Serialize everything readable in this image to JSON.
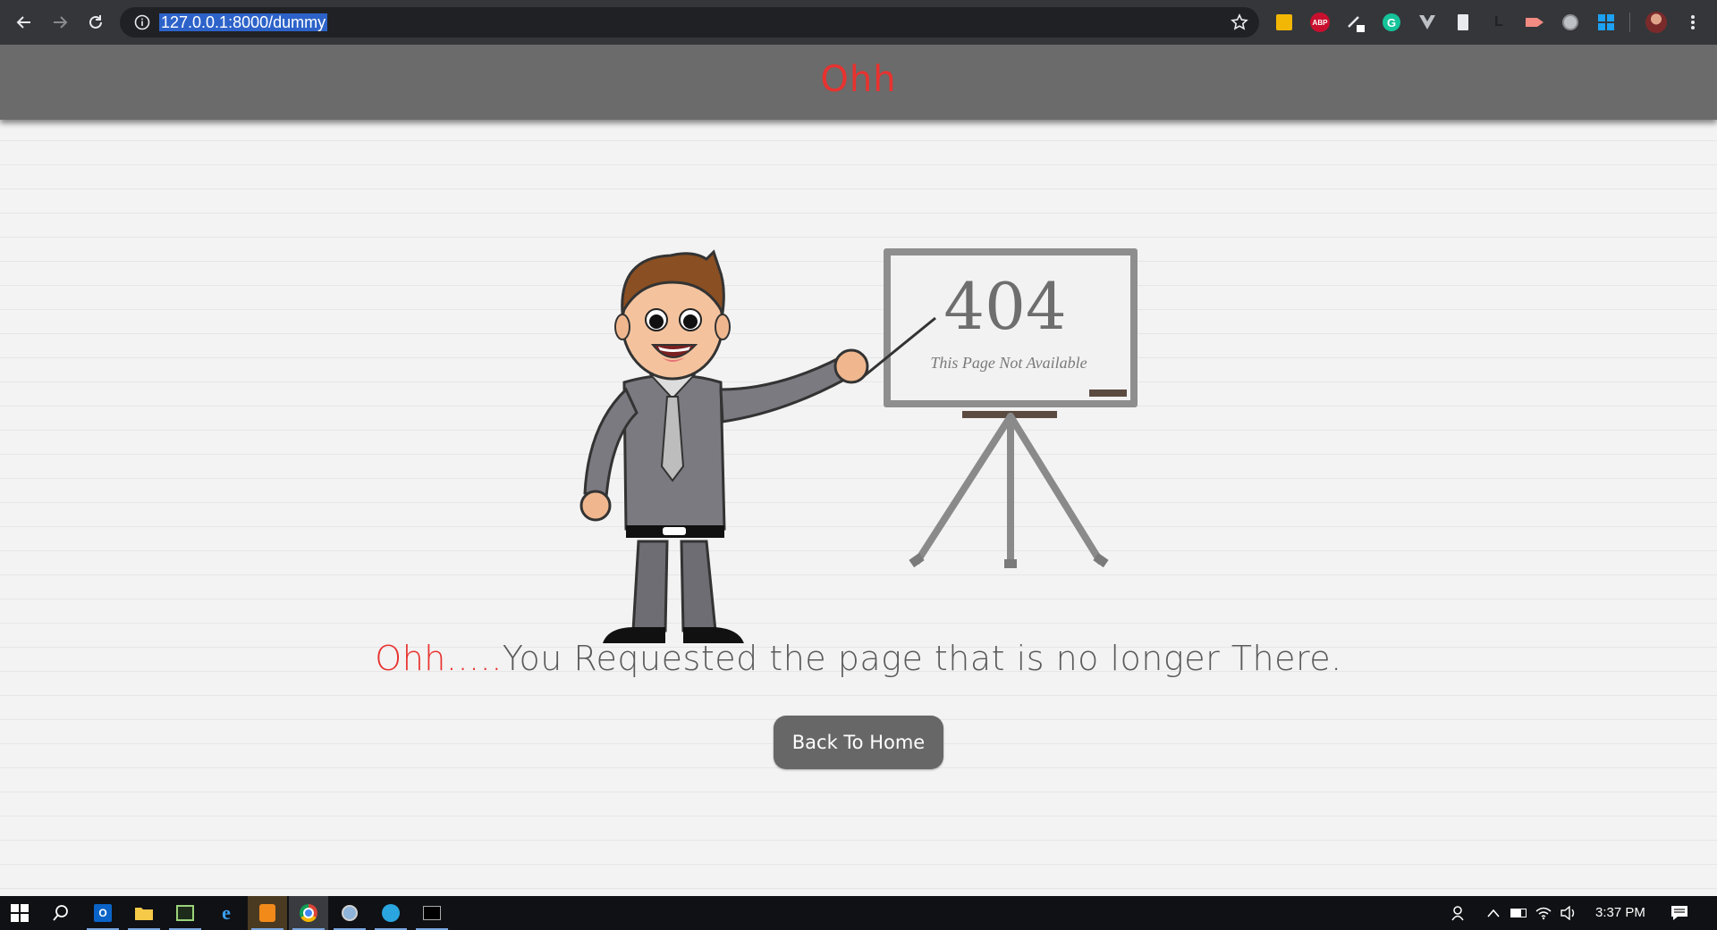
{
  "browser": {
    "url": "127.0.0.1:8000/dummy",
    "icons": [
      "back-arrow-icon",
      "forward-arrow-icon",
      "reload-icon",
      "site-info-icon",
      "bookmark-star-icon",
      "menu-dots-icon"
    ],
    "extensions": [
      "notes-extension-icon",
      "adblock-plus-icon",
      "pen-extension-icon",
      "grammarly-icon",
      "vue-devtools-icon",
      "clipboard-extension-icon",
      "l-extension-icon",
      "video-extension-icon",
      "circle-extension-icon",
      "windows-extension-icon",
      "profile-avatar"
    ],
    "adblock_label": "ABP",
    "l_label": "L"
  },
  "site": {
    "title": "Ohh",
    "accent_color": "#e8322f",
    "header_color": "#6b6b6b"
  },
  "illustration": {
    "board_code": "404",
    "board_caption": "This Page Not Available"
  },
  "message": {
    "accent": "Ohh.....",
    "text": "You Requested the page that is no longer There."
  },
  "button": {
    "label": "Back To Home"
  },
  "taskbar": {
    "apps": [
      "windows-start-icon",
      "search-icon",
      "outlook-icon",
      "file-explorer-icon",
      "terminal-app-icon",
      "internet-explorer-icon",
      "sublime-text-icon",
      "chrome-icon",
      "globe-app-icon",
      "edge-icon",
      "cmd-icon"
    ],
    "tray": [
      "people-icon",
      "chevron-up-icon",
      "battery-icon",
      "wifi-icon",
      "volume-icon",
      "notifications-icon"
    ],
    "time": "3:37 PM"
  }
}
